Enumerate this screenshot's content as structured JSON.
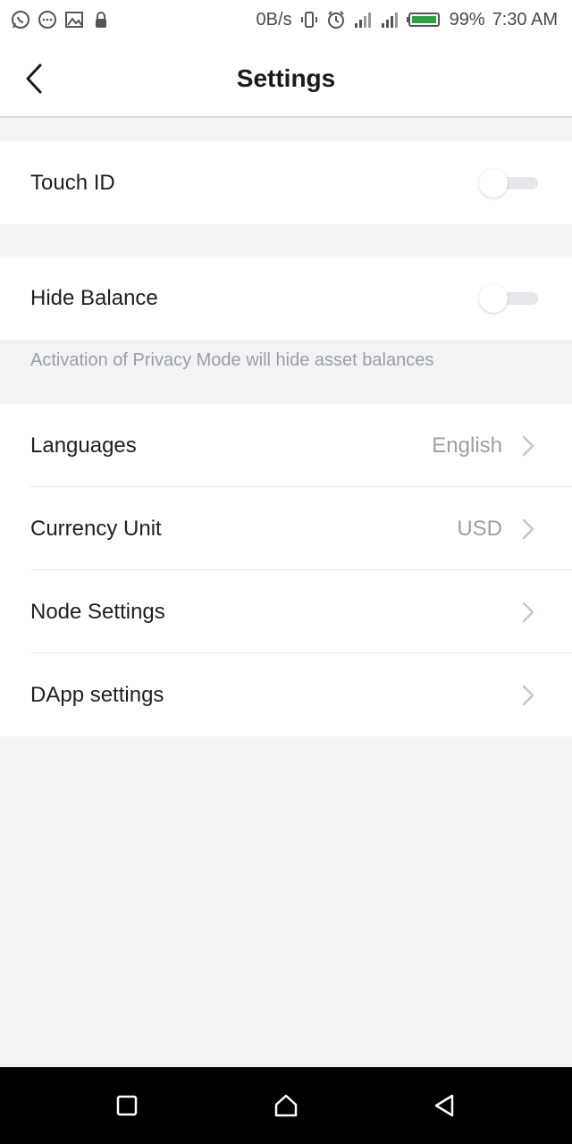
{
  "status_bar": {
    "speed": "0B/s",
    "battery": "99%",
    "time": "7:30 AM",
    "icons": [
      "whatsapp-icon",
      "chat-icon",
      "gallery-icon",
      "lock-icon",
      "vibrate-icon",
      "alarm-icon",
      "signal-icon",
      "signal-icon",
      "battery-icon"
    ]
  },
  "header": {
    "title": "Settings"
  },
  "touch_id": {
    "label": "Touch ID",
    "enabled": false
  },
  "hide_balance": {
    "label": "Hide Balance",
    "enabled": false,
    "note": "Activation of Privacy Mode will hide asset balances"
  },
  "menu": {
    "languages": {
      "label": "Languages",
      "value": "English"
    },
    "currency": {
      "label": "Currency Unit",
      "value": "USD"
    },
    "node": {
      "label": "Node Settings"
    },
    "dapp": {
      "label": "DApp settings"
    }
  },
  "nav": {
    "icons": [
      "recents-icon",
      "home-icon",
      "back-icon"
    ]
  },
  "colors": {
    "background": "#f2f3f5",
    "card": "#ffffff",
    "muted_text": "#9aa0a6",
    "navbar": "#000000"
  }
}
